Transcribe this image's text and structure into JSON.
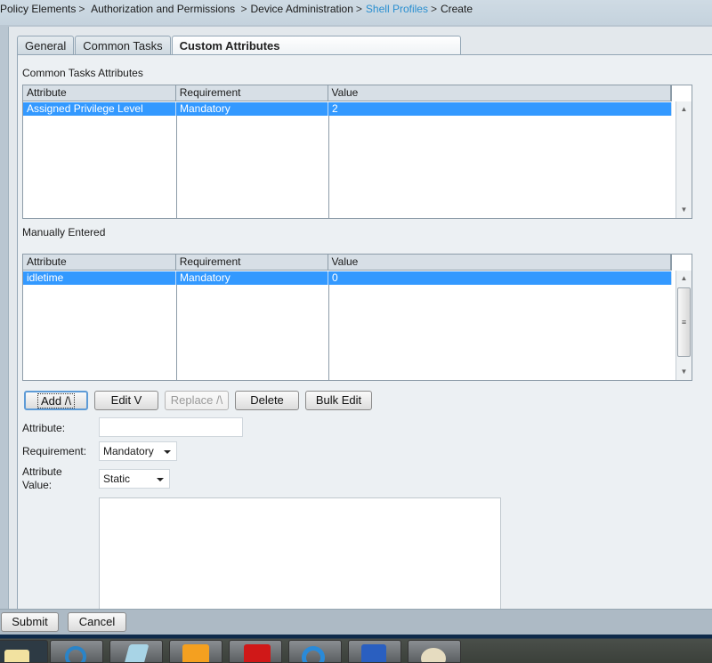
{
  "breadcrumb": [
    {
      "label": "Policy Elements",
      "link": false
    },
    {
      "label": "Authorization and Permissions",
      "link": false
    },
    {
      "label": "Device Administration",
      "link": false
    },
    {
      "label": "Shell Profiles",
      "link": true
    },
    {
      "label": "Create",
      "link": false
    }
  ],
  "breadcrumb_separator": ">",
  "tabs": [
    {
      "label": "General",
      "active": false
    },
    {
      "label": "Common Tasks",
      "active": false
    },
    {
      "label": "Custom Attributes",
      "active": true
    }
  ],
  "common_tasks": {
    "title": "Common Tasks Attributes",
    "columns": [
      "Attribute",
      "Requirement",
      "Value"
    ],
    "rows": [
      {
        "attribute": "Assigned Privilege Level",
        "requirement": "Mandatory",
        "value": "2",
        "selected": true
      }
    ]
  },
  "manual": {
    "title": "Manually Entered",
    "columns": [
      "Attribute",
      "Requirement",
      "Value"
    ],
    "rows": [
      {
        "attribute": "idletime",
        "requirement": "Mandatory",
        "value": "0",
        "selected": true
      }
    ]
  },
  "actions": {
    "add": "Add /\\",
    "edit": "Edit V",
    "replace": "Replace /\\",
    "delete": "Delete",
    "bulk_edit": "Bulk Edit"
  },
  "form": {
    "attribute_label": "Attribute:",
    "attribute_value": "",
    "requirement_label": "Requirement:",
    "requirement_selected": "Mandatory",
    "attr_value_label_line1": "Attribute",
    "attr_value_label_line2": "Value:",
    "attr_value_type_selected": "Static",
    "attr_value_text": ""
  },
  "footer": {
    "submit": "Submit",
    "cancel": "Cancel"
  },
  "taskbar": {
    "items": [
      "windows-explorer",
      "media-app",
      "notepad-app",
      "outlook-app",
      "acrobat-reader",
      "internet-explorer",
      "word-app",
      "paint-app"
    ]
  },
  "colors": {
    "selection": "#3399ff",
    "link": "#2a8fd0"
  }
}
